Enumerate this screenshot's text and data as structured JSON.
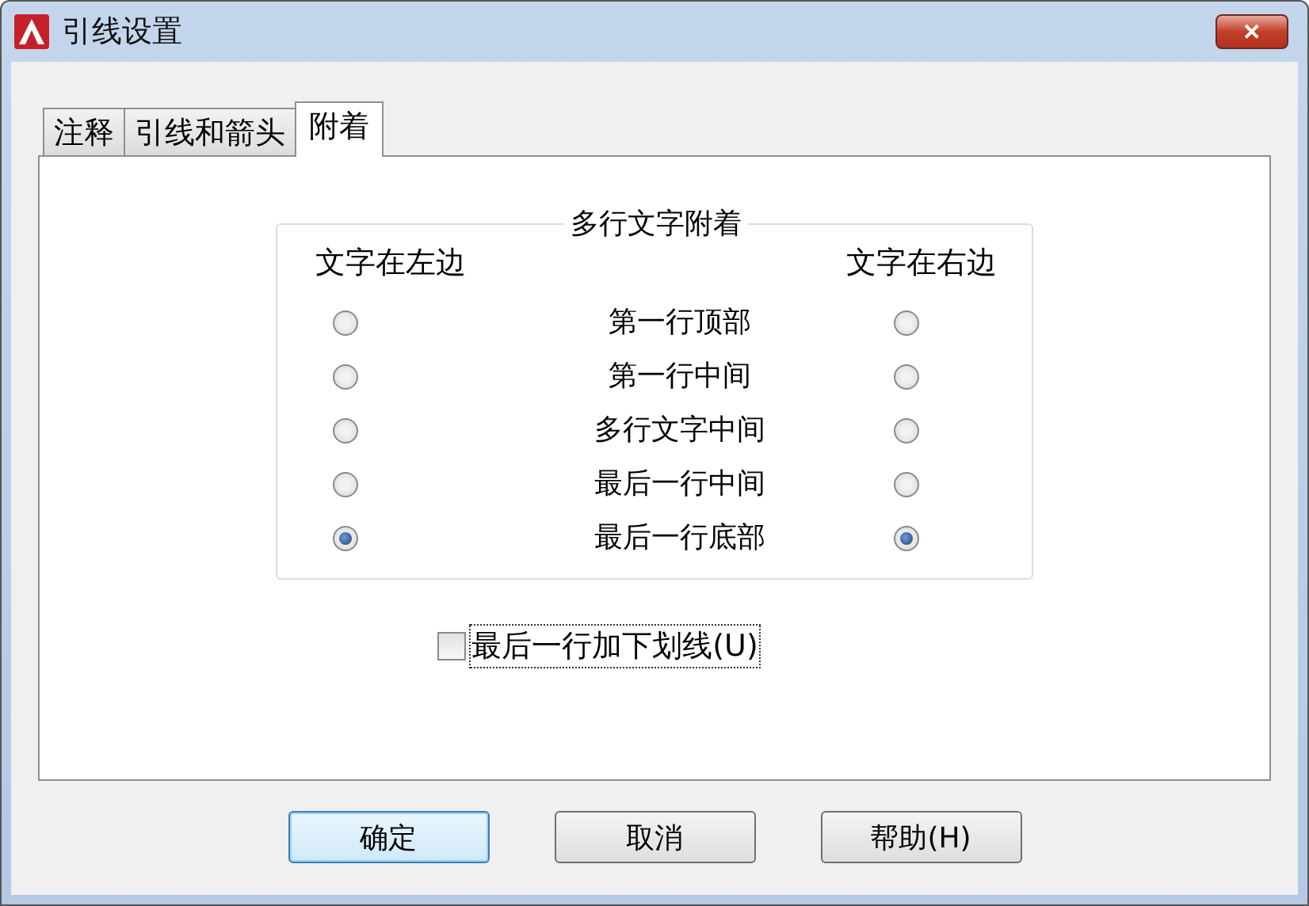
{
  "window": {
    "title": "引线设置",
    "close": "✕"
  },
  "tabs": [
    {
      "label": "注释",
      "selected": false
    },
    {
      "label": "引线和箭头",
      "selected": false
    },
    {
      "label": "附着",
      "selected": true
    }
  ],
  "group": {
    "title": "多行文字附着",
    "left_header": "文字在左边",
    "right_header": "文字在右边",
    "rows": [
      {
        "label": "第一行顶部",
        "left": {
          "selected": false
        },
        "right": {
          "selected": false
        }
      },
      {
        "label": "第一行中间",
        "left": {
          "selected": false
        },
        "right": {
          "selected": false
        }
      },
      {
        "label": "多行文字中间",
        "left": {
          "selected": false
        },
        "right": {
          "selected": false
        }
      },
      {
        "label": "最后一行中间",
        "left": {
          "selected": false
        },
        "right": {
          "selected": false
        }
      },
      {
        "label": "最后一行底部",
        "left": {
          "selected": true
        },
        "right": {
          "selected": true
        }
      }
    ]
  },
  "underline_option": {
    "label": "最后一行加下划线(U)",
    "checked": false
  },
  "buttons": [
    {
      "label": "确定",
      "default": true
    },
    {
      "label": "取消",
      "default": false
    },
    {
      "label": "帮助(H)",
      "default": false
    }
  ]
}
